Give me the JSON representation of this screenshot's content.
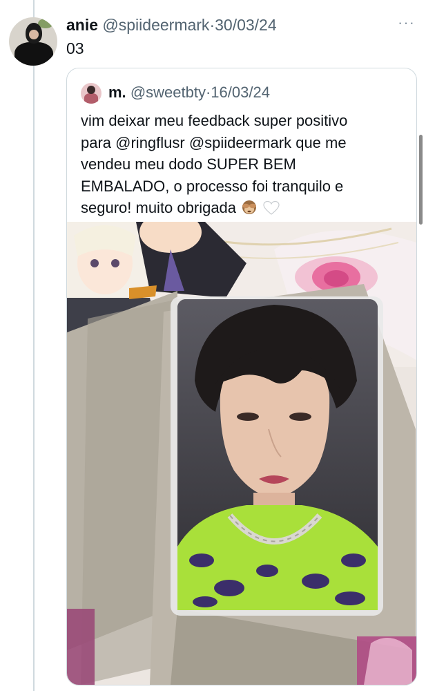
{
  "tweet": {
    "author_name": "anie",
    "author_handle": "@spiideermark",
    "separator": "·",
    "date": "30/03/24",
    "text": "03",
    "more_label": "···"
  },
  "quoted_tweet": {
    "author_name": "m.",
    "author_handle": "@sweetbty",
    "separator": "·",
    "date": "16/03/24",
    "text_lines": [
      "vim deixar meu feedback super positivo",
      "para @ringflusr @spiideermark que me",
      "vendeu meu dodo SUPER BEM",
      "EMBALADO, o processo foi tranquilo e",
      "seguro! muito obrigada"
    ],
    "emojis": [
      "see-no-evil-monkey",
      "white-heart"
    ]
  },
  "colors": {
    "thread_line": "#cfd9de",
    "secondary_text": "#536471",
    "border": "#cfd9de",
    "photocard_shirt_green": "#a9e03a"
  }
}
